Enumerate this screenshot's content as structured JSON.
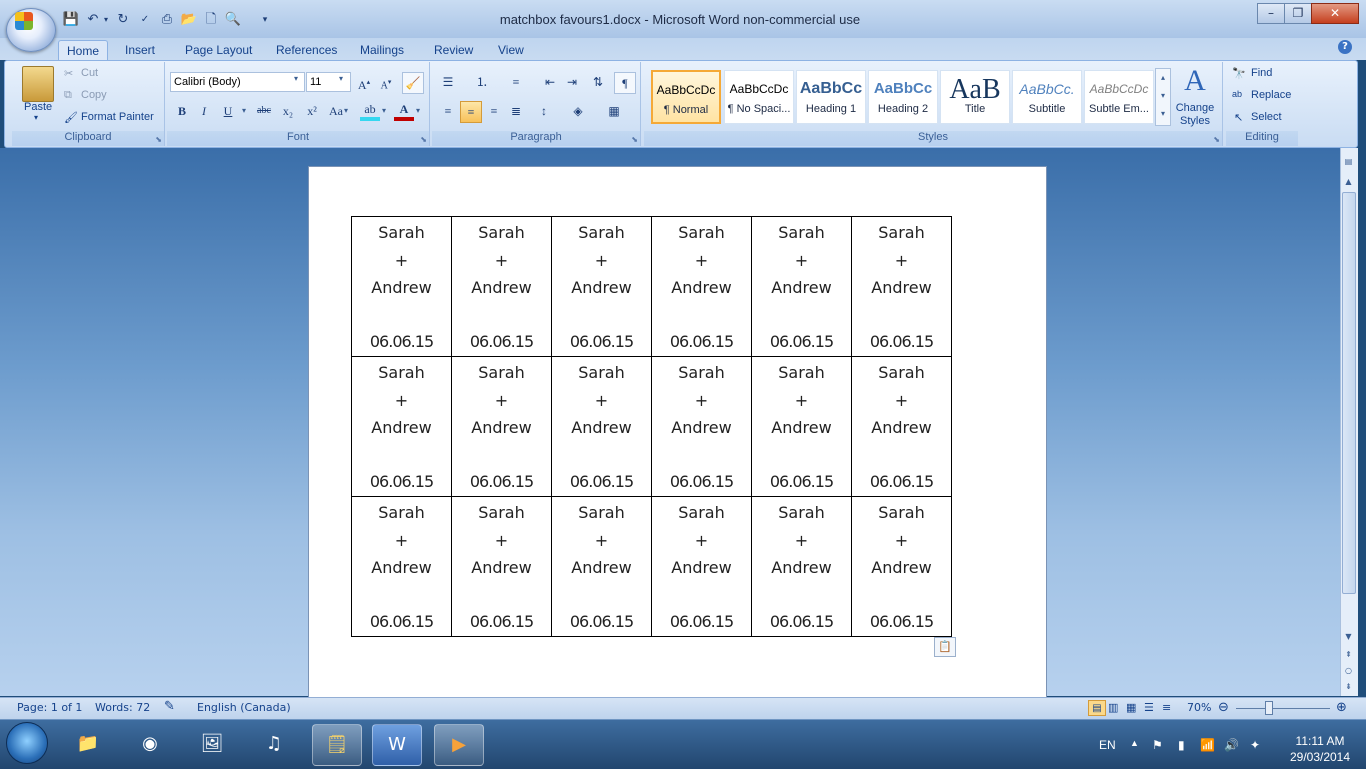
{
  "window": {
    "title": "matchbox favours1.docx - Microsoft Word non-commercial use",
    "controls": {
      "minimize": "–",
      "maximize": "❐",
      "close": "✕"
    }
  },
  "ribbon_tabs": [
    "Home",
    "Insert",
    "Page Layout",
    "References",
    "Mailings",
    "Review",
    "View"
  ],
  "active_tab": "Home",
  "clipboard": {
    "paste": "Paste",
    "cut": "Cut",
    "copy": "Copy",
    "format_painter": "Format Painter",
    "group_label": "Clipboard"
  },
  "font": {
    "font_name": "Calibri (Body)",
    "font_size": "11",
    "group_label": "Font",
    "bold": "B",
    "italic": "I",
    "underline": "U",
    "strike": "abc",
    "subscript": "x₂",
    "superscript": "x²",
    "change_case": "Aa"
  },
  "paragraph": {
    "group_label": "Paragraph",
    "show_marks": "¶"
  },
  "styles": {
    "group_label": "Styles",
    "tiles": [
      {
        "sample": "AaBbCcDc",
        "name": "¶ Normal"
      },
      {
        "sample": "AaBbCcDc",
        "name": "¶ No Spaci..."
      },
      {
        "sample": "AaBbCc",
        "name": "Heading 1"
      },
      {
        "sample": "AaBbCc",
        "name": "Heading 2"
      },
      {
        "sample": "AaB",
        "name": "Title"
      },
      {
        "sample": "AaBbCc.",
        "name": "Subtitle"
      },
      {
        "sample": "AaBbCcDc",
        "name": "Subtle Em..."
      }
    ],
    "change_styles": "Change Styles"
  },
  "editing": {
    "group_label": "Editing",
    "find": "Find",
    "replace": "Replace",
    "select": "Select"
  },
  "document": {
    "labels": {
      "name1": "Sarah",
      "plus": "+",
      "name2": "Andrew",
      "date": "06.06.15"
    }
  },
  "status": {
    "page": "Page: 1 of 1",
    "words": "Words: 72",
    "language": "English (Canada)",
    "zoom": "70%"
  },
  "taskbar": {
    "lang": "EN",
    "time": "11:11 AM",
    "date": "29/03/2014"
  }
}
